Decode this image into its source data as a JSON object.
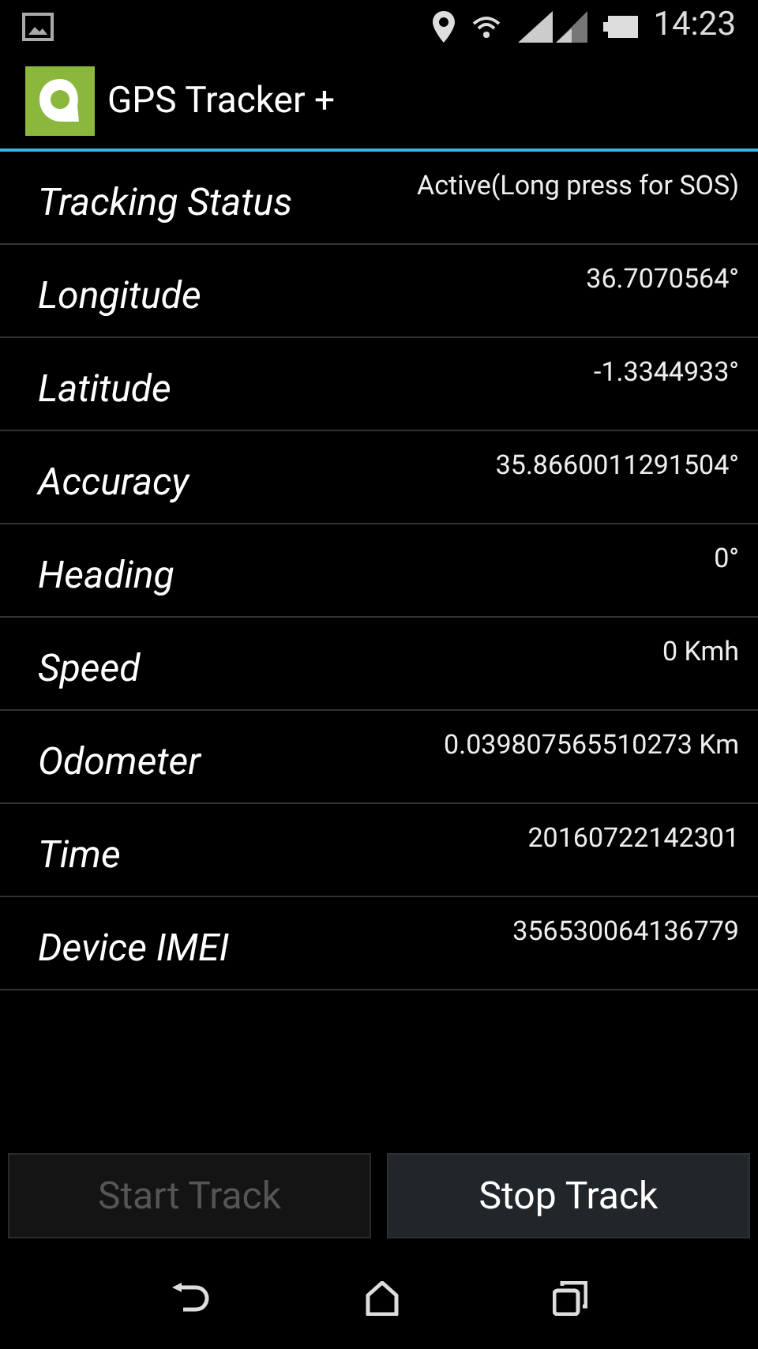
{
  "status_bar": {
    "time": "14:23"
  },
  "action_bar": {
    "title": "GPS Tracker +"
  },
  "rows": [
    {
      "label": "Tracking Status",
      "value": "Active(Long press for SOS)"
    },
    {
      "label": "Longitude",
      "value": "36.7070564°"
    },
    {
      "label": "Latitude",
      "value": "-1.3344933°"
    },
    {
      "label": "Accuracy",
      "value": "35.8660011291504°"
    },
    {
      "label": "Heading",
      "value": "0°"
    },
    {
      "label": "Speed",
      "value": "0 Kmh"
    },
    {
      "label": "Odometer",
      "value": "0.039807565510273 Km"
    },
    {
      "label": "Time",
      "value": "20160722142301"
    },
    {
      "label": "Device IMEI",
      "value": "356530064136779"
    }
  ],
  "buttons": [
    {
      "label": "Start Track",
      "disabled": true
    },
    {
      "label": "Stop Track",
      "disabled": false
    }
  ]
}
